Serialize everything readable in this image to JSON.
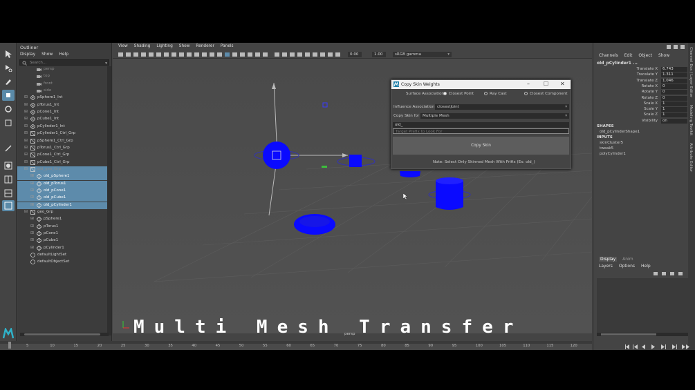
{
  "outliner": {
    "title": "Outliner",
    "menu": [
      "Display",
      "Show",
      "Help"
    ],
    "search_placeholder": "Search...",
    "rows": [
      {
        "label": "persp",
        "indent": 1,
        "icon": "camera",
        "dim": true
      },
      {
        "label": "top",
        "indent": 1,
        "icon": "camera",
        "dim": true
      },
      {
        "label": "front",
        "indent": 1,
        "icon": "camera",
        "dim": true
      },
      {
        "label": "side",
        "indent": 1,
        "icon": "camera",
        "dim": true
      },
      {
        "label": "pSphere1_Int",
        "indent": 0,
        "icon": "transform",
        "plus": true
      },
      {
        "label": "pTorus1_Int",
        "indent": 0,
        "icon": "transform",
        "plus": true
      },
      {
        "label": "pCone1_Int",
        "indent": 0,
        "icon": "transform",
        "plus": true
      },
      {
        "label": "pCube1_Int",
        "indent": 0,
        "icon": "transform",
        "plus": true
      },
      {
        "label": "pCylinder1_Int",
        "indent": 0,
        "icon": "transform",
        "plus": true
      },
      {
        "label": "pCylinder1_Ctrl_Grp",
        "indent": 0,
        "icon": "group",
        "plus": true
      },
      {
        "label": "pSphere1_Ctrl_Grp",
        "indent": 0,
        "icon": "group",
        "plus": true
      },
      {
        "label": "pTorus1_Ctrl_Grp",
        "indent": 0,
        "icon": "group",
        "plus": true
      },
      {
        "label": "pCone1_Ctrl_Grp",
        "indent": 0,
        "icon": "group",
        "plus": true
      },
      {
        "label": "pCube1_Ctrl_Grp",
        "indent": 0,
        "icon": "group",
        "plus": true
      },
      {
        "label": "old_geo_Grp",
        "indent": 0,
        "icon": "group",
        "minus": true,
        "hl": true,
        "dim": true
      },
      {
        "label": "old_pSphere1",
        "indent": 1,
        "icon": "mesh",
        "plus": true,
        "hl": true
      },
      {
        "label": "old_pTorus1",
        "indent": 1,
        "icon": "mesh",
        "plus": true,
        "hl": true
      },
      {
        "label": "old_pCone1",
        "indent": 1,
        "icon": "mesh",
        "plus": true,
        "hl": true
      },
      {
        "label": "old_pCube1",
        "indent": 1,
        "icon": "mesh",
        "plus": true,
        "hl": true
      },
      {
        "label": "old_pCylinder1",
        "indent": 1,
        "icon": "mesh",
        "plus": true,
        "hl": true
      },
      {
        "label": "geo_Grp",
        "indent": 0,
        "icon": "group",
        "minus": true
      },
      {
        "label": "pSphere1",
        "indent": 1,
        "icon": "mesh",
        "plus": true
      },
      {
        "label": "pTorus1",
        "indent": 1,
        "icon": "mesh",
        "plus": true
      },
      {
        "label": "pCone1",
        "indent": 1,
        "icon": "mesh",
        "plus": true
      },
      {
        "label": "pCube1",
        "indent": 1,
        "icon": "mesh",
        "plus": true
      },
      {
        "label": "pCylinder1",
        "indent": 1,
        "icon": "mesh",
        "plus": true
      },
      {
        "label": "defaultLightSet",
        "indent": 0,
        "icon": "set"
      },
      {
        "label": "defaultObjectSet",
        "indent": 0,
        "icon": "set"
      }
    ]
  },
  "viewport": {
    "menu": [
      "View",
      "Shading",
      "Lighting",
      "Show",
      "Renderer",
      "Panels"
    ],
    "field_a": "0.00",
    "field_b": "1.00",
    "colorspace": "sRGB gamma",
    "camera_label": "persp",
    "overlay_title": "Multi Mesh Transfer"
  },
  "dialog": {
    "title": "Copy Skin Weights",
    "surface_label": "Surface Association",
    "surface_options": [
      "Closest Point",
      "Ray Cast",
      "Closest Component"
    ],
    "influence_label": "Influence Association",
    "influence_value": "closestJoint",
    "copy_for_label": "Copy Skin for",
    "copy_for_value": "Multiple Mesh",
    "prefix_value": "old_",
    "target_placeholder": "Target Prefix to Look For",
    "copy_button": "Copy Skin",
    "note": "Note: Select Only Skinned Mesh With Prifix (Ex: old_)"
  },
  "channel_box": {
    "menu": [
      "Channels",
      "Edit",
      "Object",
      "Show"
    ],
    "object": "old_pCylinder1 ...",
    "attrs": [
      {
        "name": "Translate X",
        "value": "6.743"
      },
      {
        "name": "Translate Y",
        "value": "1.311"
      },
      {
        "name": "Translate Z",
        "value": "1.046"
      },
      {
        "name": "Rotate X",
        "value": "0"
      },
      {
        "name": "Rotate Y",
        "value": "0"
      },
      {
        "name": "Rotate Z",
        "value": "0"
      },
      {
        "name": "Scale X",
        "value": "1"
      },
      {
        "name": "Scale Y",
        "value": "1"
      },
      {
        "name": "Scale Z",
        "value": "1"
      },
      {
        "name": "Visibility",
        "value": "on"
      }
    ],
    "shapes_label": "SHAPES",
    "shape": "old_pCylinderShape1",
    "inputs_label": "INPUTS",
    "inputs": [
      "skinCluster5",
      "tweak5",
      "polyCylinder1"
    ],
    "layer_tabs": [
      "Display",
      "Anim"
    ],
    "layer_menu": [
      "Layers",
      "Options",
      "Help"
    ],
    "side_tabs": [
      "Channel Box / Layer Editor",
      "Modeling Toolkit",
      "Attribute Editor"
    ]
  },
  "timeline": {
    "ticks": [
      "5",
      "10",
      "15",
      "20",
      "25",
      "30",
      "35",
      "40",
      "45",
      "50",
      "55",
      "60",
      "65",
      "70",
      "75",
      "80",
      "85",
      "90",
      "95",
      "100",
      "105",
      "110",
      "115",
      "120"
    ]
  },
  "colors": {
    "accent": "#5d8bab",
    "mesh": "#0a0aff"
  }
}
